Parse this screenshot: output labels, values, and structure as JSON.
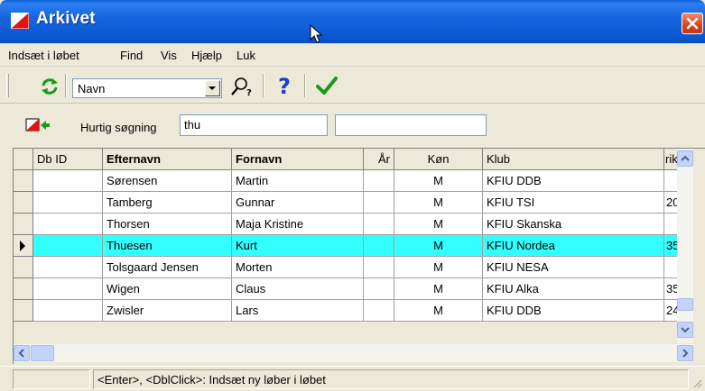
{
  "window": {
    "title": "Arkivet",
    "icon": "app-flag-icon",
    "close_icon": "close-icon"
  },
  "menu": {
    "items": [
      "Indsæt i løbet",
      "Find",
      "Vis",
      "Hjælp",
      "Luk"
    ]
  },
  "toolbar": {
    "refresh_icon": "refresh-icon",
    "sort_combo_value": "Navn",
    "search_icon": "find-icon",
    "help_icon": "help-icon",
    "ok_icon": "checkmark-icon"
  },
  "search": {
    "label": "Hurtig søgning",
    "value": "thu",
    "value2": "",
    "back_icon": "back-arrow-icon"
  },
  "grid": {
    "columns": [
      "Db ID",
      "Efternavn",
      "Fornavn",
      "År",
      "Køn",
      "Klub",
      "rik"
    ],
    "rows": [
      {
        "db_id": "",
        "efternavn": "Sørensen",
        "fornavn": "Martin",
        "aar": "",
        "koen": "M",
        "klub": "KFIU DDB",
        "extra": ""
      },
      {
        "db_id": "",
        "efternavn": "Tamberg",
        "fornavn": "Gunnar",
        "aar": "",
        "koen": "M",
        "klub": "KFIU TSI",
        "extra": "20"
      },
      {
        "db_id": "",
        "efternavn": "Thorsen",
        "fornavn": "Maja Kristine",
        "aar": "",
        "koen": "M",
        "klub": "KFIU Skanska",
        "extra": ""
      },
      {
        "db_id": "",
        "efternavn": "Thuesen",
        "fornavn": "Kurt",
        "aar": "",
        "koen": "M",
        "klub": "KFIU Nordea",
        "extra": "35"
      },
      {
        "db_id": "",
        "efternavn": "Tolsgaard Jensen",
        "fornavn": "Morten",
        "aar": "",
        "koen": "M",
        "klub": "KFIU NESA",
        "extra": ""
      },
      {
        "db_id": "",
        "efternavn": "Wigen",
        "fornavn": "Claus",
        "aar": "",
        "koen": "M",
        "klub": "KFIU Alka",
        "extra": "35"
      },
      {
        "db_id": "",
        "efternavn": "Zwisler",
        "fornavn": "Lars",
        "aar": "",
        "koen": "M",
        "klub": "KFIU DDB",
        "extra": "24"
      }
    ],
    "selected_row": 3,
    "selected_color": "#33fffe"
  },
  "status": {
    "hint": "<Enter>, <DblClick>: Indsæt ny løber i løbet"
  }
}
